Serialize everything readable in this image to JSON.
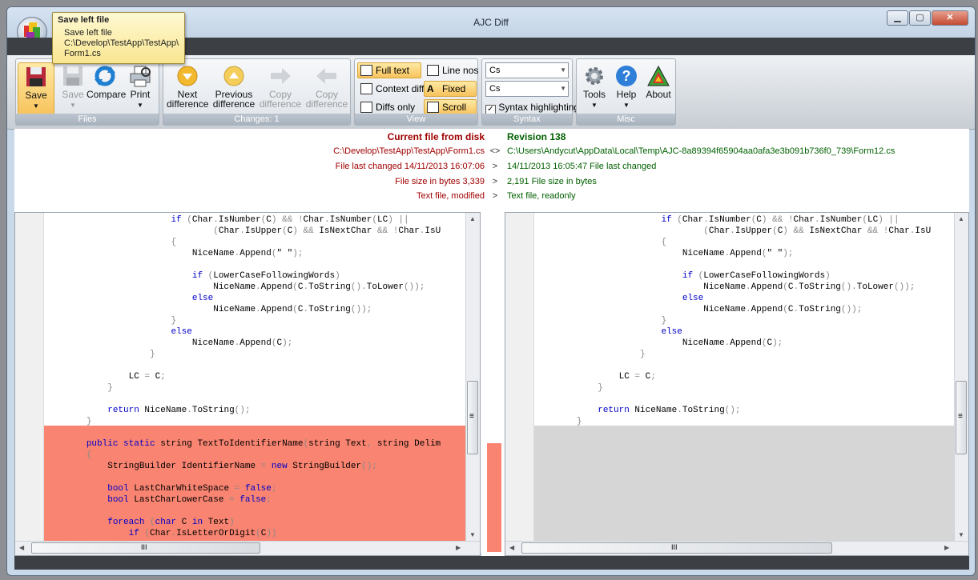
{
  "window": {
    "title": "AJC Diff"
  },
  "tooltip": {
    "title": "Save left file",
    "line1": "Save left file",
    "line2": "C:\\Develop\\TestApp\\TestApp\\",
    "line3": "Form1.cs"
  },
  "ribbon": {
    "files": {
      "label": "Files",
      "save": "Save",
      "save_right": "Save",
      "compare": "Compare",
      "print": "Print"
    },
    "changes": {
      "label": "Changes: 1",
      "next1": "Next",
      "next2": "difference",
      "prev1": "Previous",
      "prev2": "difference",
      "copy1": "Copy",
      "copy2": "difference",
      "copyb1": "Copy",
      "copyb2": "difference"
    },
    "view": {
      "label": "View",
      "full_text": "Full text",
      "context_diff": "Context diff",
      "diffs_only": "Diffs only",
      "line_nos": "Line nos",
      "fixed": "Fixed",
      "scroll": "Scroll"
    },
    "syntax": {
      "label": "Syntax",
      "combo1": "Cs",
      "combo2": "Cs",
      "highlight": "Syntax highlighting"
    },
    "misc": {
      "label": "Misc",
      "tools": "Tools",
      "help": "Help",
      "about": "About"
    }
  },
  "left_file": {
    "heading": "Current file from disk",
    "path": "C:\\Develop\\TestApp\\TestApp\\Form1.cs",
    "changed": "File last changed 14/11/2013 16:07:06",
    "size": "File size in bytes 3,339",
    "type": "Text file, modified"
  },
  "right_file": {
    "heading": "Revision 138",
    "path": "C:\\Users\\Andycut\\AppData\\Local\\Temp\\AJC-8a89394f65904aa0afa3e3b091b736f0_739\\Form12.cs",
    "changed": "14/11/2013 16:05:47 File last changed",
    "size": "2,191 File size in bytes",
    "type": "Text file, readonly"
  },
  "compare_symbols": {
    "path": "<>",
    "changed": ">",
    "size": ">",
    "type": ">"
  },
  "scroll_labels": {
    "grip": "≡",
    "hgrip": "III"
  },
  "colors": {
    "diff_removed": "#f98471",
    "diff_absent": "#d6d6d6",
    "keyword": "#0000c8"
  }
}
